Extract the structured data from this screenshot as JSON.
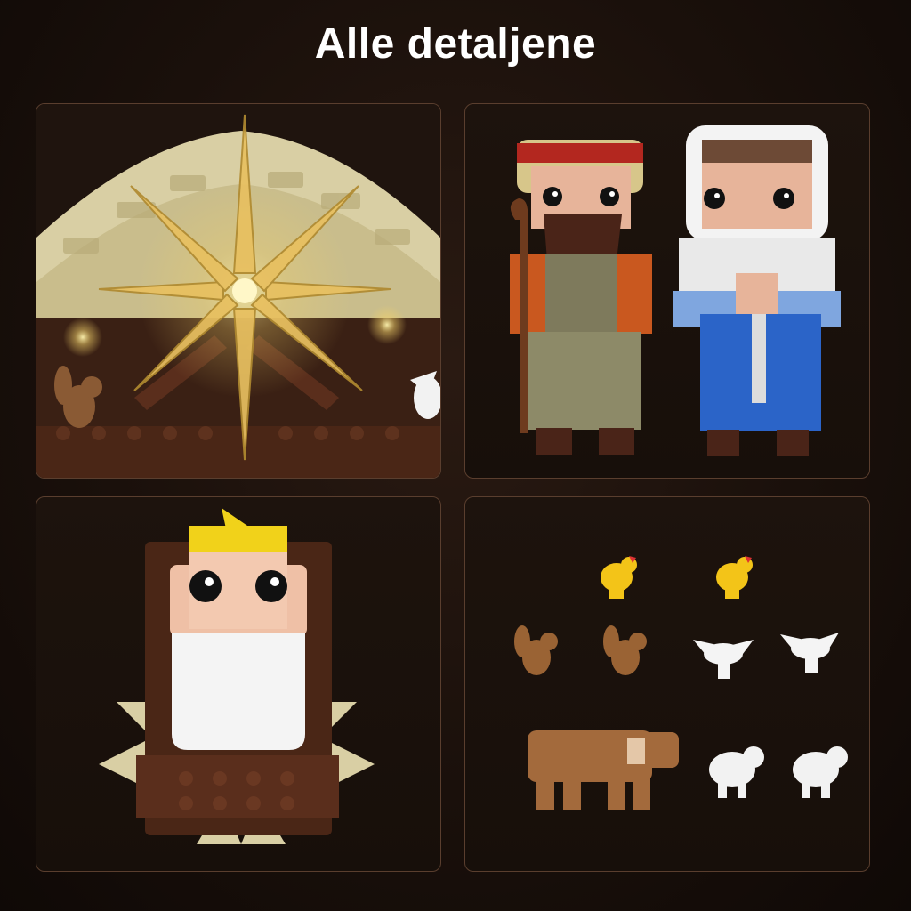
{
  "header": {
    "title": "Alle detaljene"
  },
  "panels": [
    {
      "id": "stable-star",
      "depicts": "stable-roof-with-star"
    },
    {
      "id": "figures",
      "depicts": "joseph-and-mary-figures"
    },
    {
      "id": "baby",
      "depicts": "baby-in-manger"
    },
    {
      "id": "animals",
      "depicts": "animal-figures"
    }
  ],
  "colors": {
    "background": "#1a100b",
    "panel_border": "#5a3e2e",
    "title": "#ffffff",
    "star_glow": "#f3d26a",
    "brick_brown": "#5a2e1c",
    "straw": "#d9cfa4"
  }
}
